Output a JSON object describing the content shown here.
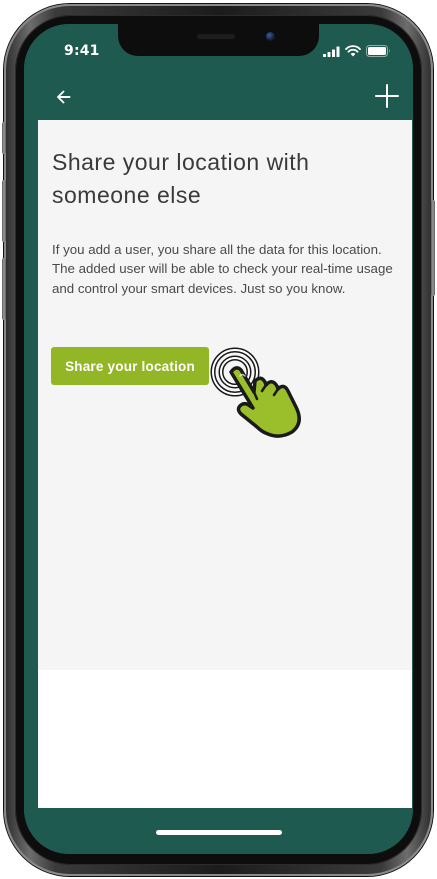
{
  "status_bar": {
    "time": "9:41",
    "icons": [
      "signal-icon",
      "wifi-icon",
      "battery-icon"
    ]
  },
  "app_bar": {
    "back_icon": "arrow-left-icon",
    "add_icon": "plus-icon"
  },
  "main": {
    "title": "Share your location with someone else",
    "description": "If you add a user, you share all the data for this location. The added user will be able to check your real-time usage and control your smart devices. Just so you know.",
    "share_button_label": "Share your location",
    "pointer_icon": "tapping-hand-icon"
  },
  "colors": {
    "app_bar": "#1e5a4f",
    "content_background": "#f5f5f5",
    "accent_button": "#93b626",
    "hand_fill": "#9bbf2a"
  }
}
